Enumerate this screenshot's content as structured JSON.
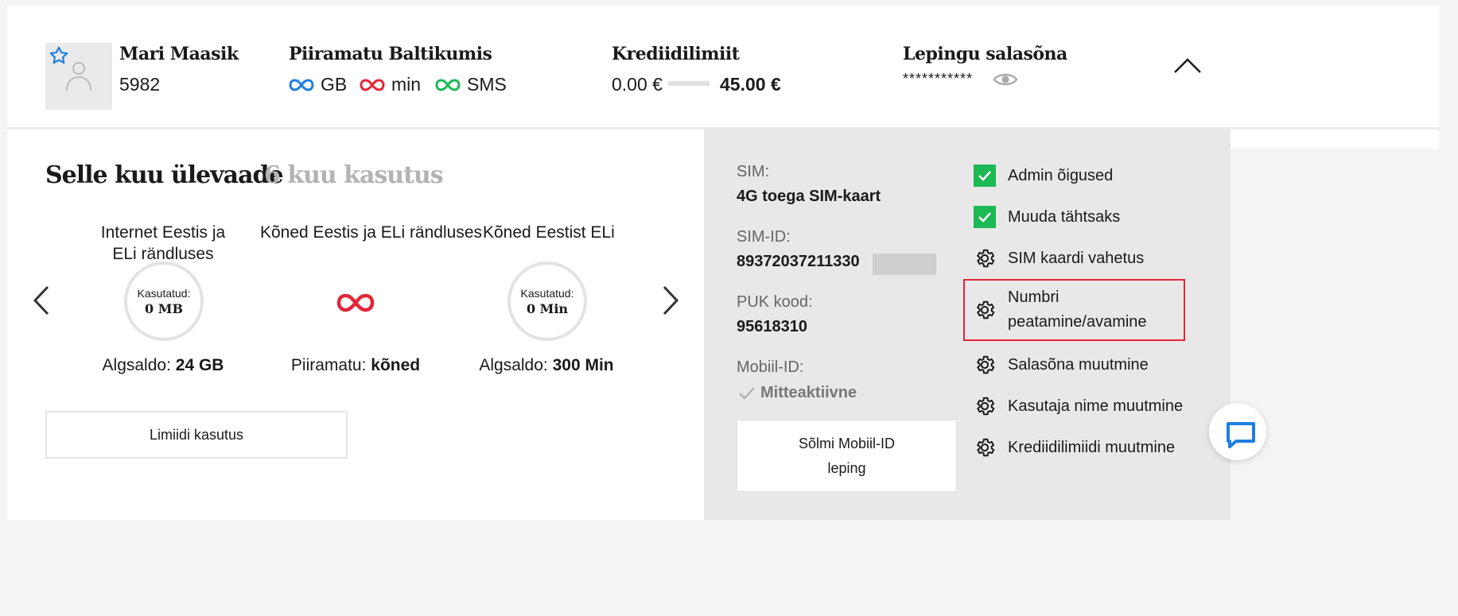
{
  "header": {
    "user_name": "Mari Maasik",
    "user_number": "5982‹",
    "plan_title": "Piiramatu Baltikumis",
    "unlimited": [
      {
        "label": "GB",
        "color": "#1e7fe0"
      },
      {
        "label": "min",
        "color": "#e3263a"
      },
      {
        "label": "SMS",
        "color": "#1db954"
      }
    ],
    "credit_title": "Krediidilimiit",
    "credit_used": "0.00 €",
    "credit_limit": "45.00 €",
    "password_title": "Lepingu salasõna",
    "password_mask": "***********"
  },
  "overview": {
    "tab_active": "Selle kuu ülevaade",
    "tab_inactive": "6 kuu kasutus",
    "columns": [
      {
        "title": "Internet Eestis ja ELi rändluses",
        "ring_label": "Kasutatud:",
        "ring_value": "0 MB",
        "saldo_label": "Algsaldo:",
        "saldo_value": "24 GB"
      },
      {
        "title": "Kõned Eestis ja ELi rändluses",
        "saldo_label": "Piiramatu:",
        "saldo_value": "kõned"
      },
      {
        "title": "Kõned Eestist ELi",
        "ring_label": "Kasutatud:",
        "ring_value": "0 Min",
        "saldo_label": "Algsaldo:",
        "saldo_value": "300 Min"
      }
    ],
    "limit_button": "Limiidi kasutus"
  },
  "sim": {
    "sim_label": "SIM:",
    "sim_value": "4G toega SIM-kaart",
    "simid_label": "SIM-ID:",
    "simid_value": "89372037211330",
    "puk_label": "PUK kood:",
    "puk_value": "95618310",
    "mobiilid_label": "Mobiil-ID:",
    "mobiilid_status": "Mitteaktiivne",
    "mobiilid_button": "Sõlmi Mobiil-ID leping"
  },
  "actions": [
    {
      "label": "Admin õigused",
      "icon": "checkbox-checked-icon"
    },
    {
      "label": "Muuda tähtsaks",
      "icon": "checkbox-checked-icon"
    },
    {
      "label": "SIM kaardi vahetus",
      "icon": "gear-icon"
    },
    {
      "label": "Numbri peatamine/avamine",
      "icon": "gear-icon"
    },
    {
      "label": "Salasõna muutmine",
      "icon": "gear-icon"
    },
    {
      "label": "Kasutaja nime muutmine",
      "icon": "gear-icon"
    },
    {
      "label": "Krediidilimiidi muutmine",
      "icon": "gear-icon"
    }
  ],
  "colors": {
    "accent_blue": "#1e7fe0",
    "accent_red": "#e3263a",
    "accent_green": "#1db954"
  }
}
